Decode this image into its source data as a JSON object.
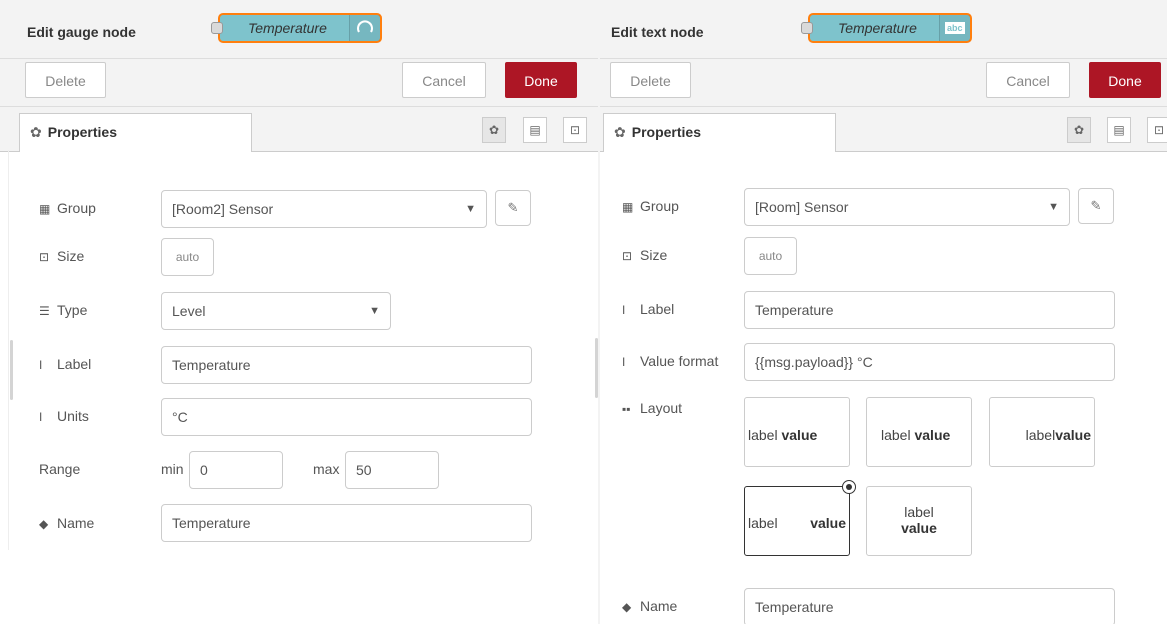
{
  "left": {
    "title": "Edit gauge node",
    "node_label": "Temperature",
    "delete_label": "Delete",
    "cancel_label": "Cancel",
    "done_label": "Done",
    "tab_label": "Properties",
    "fields": {
      "group_label": "Group",
      "group_value": "[Room2] Sensor",
      "size_label": "Size",
      "size_value": "auto",
      "type_label": "Type",
      "type_value": "Level",
      "label_label": "Label",
      "label_value": "Temperature",
      "units_label": "Units",
      "units_value": "°C",
      "range_label": "Range",
      "min_label": "min",
      "min_value": "0",
      "max_label": "max",
      "max_value": "50",
      "name_label": "Name",
      "name_value": "Temperature"
    }
  },
  "right": {
    "title": "Edit text node",
    "node_label": "Temperature",
    "node_icon_text": "abc",
    "delete_label": "Delete",
    "cancel_label": "Cancel",
    "done_label": "Done",
    "tab_label": "Properties",
    "fields": {
      "group_label": "Group",
      "group_value": "[Room] Sensor",
      "size_label": "Size",
      "size_value": "auto",
      "label_label": "Label",
      "label_value": "Temperature",
      "format_label": "Value format",
      "format_value": "{{msg.payload}} °C",
      "layout_label": "Layout",
      "name_label": "Name",
      "name_value": "Temperature"
    },
    "layout_options": [
      {
        "label": "label",
        "value": "value"
      },
      {
        "label": "label",
        "value": "value"
      },
      {
        "label": "label",
        "value": "value"
      },
      {
        "label": "label",
        "value": "value"
      },
      {
        "label": "label",
        "value": "value"
      }
    ]
  },
  "colors": {
    "node_fill": "#7ec3cc",
    "node_border": "#ff7f0e",
    "done_button": "#ad1625"
  },
  "icons": {
    "tab": "gear-icon",
    "group": "table-icon",
    "size": "resize-icon",
    "type": "list-icon",
    "label": "text-cursor-icon",
    "name": "tag-icon",
    "layout": "grid-icon"
  }
}
